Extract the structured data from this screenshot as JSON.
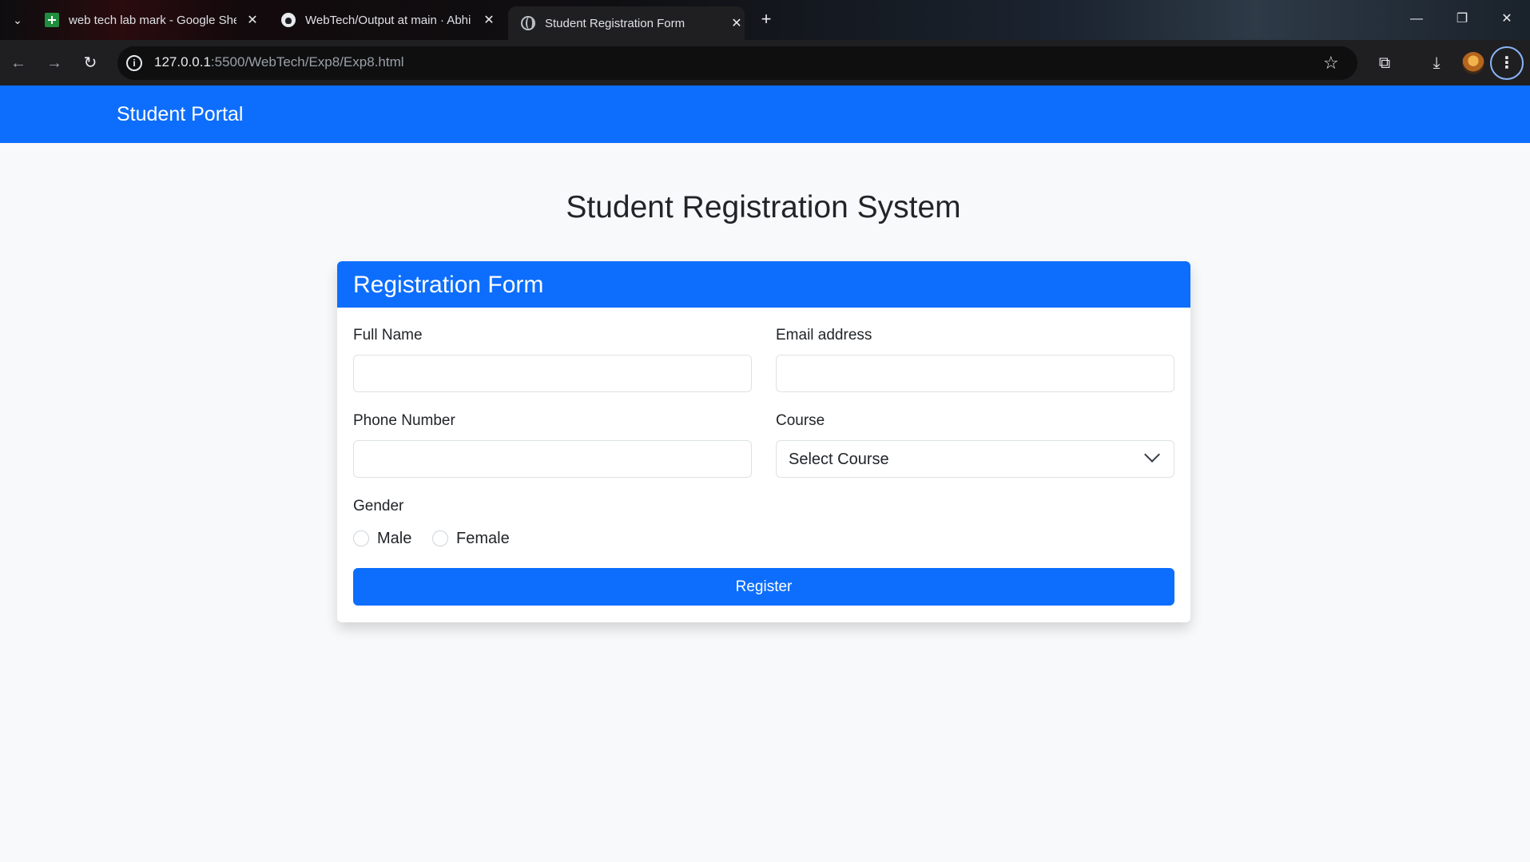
{
  "browser": {
    "tabs": [
      {
        "title": "web tech lab mark - Google Sheets",
        "icon": "sheets-icon"
      },
      {
        "title": "WebTech/Output at main · Abhi",
        "icon": "github-icon"
      },
      {
        "title": "Student Registration Form",
        "icon": "globe-icon",
        "active": true
      }
    ],
    "url_host": "127.0.0.1",
    "url_path": ":5500/WebTech/Exp8/Exp8.html"
  },
  "navbar": {
    "brand": "Student Portal"
  },
  "main": {
    "title": "Student Registration System"
  },
  "form": {
    "header": "Registration Form",
    "full_name_label": "Full Name",
    "full_name_value": "",
    "email_label": "Email address",
    "email_value": "",
    "phone_label": "Phone Number",
    "phone_value": "",
    "course_label": "Course",
    "course_selected": "Select Course",
    "gender_label": "Gender",
    "gender_options": [
      "Male",
      "Female"
    ],
    "submit_label": "Register"
  },
  "colors": {
    "primary": "#0d6efd",
    "page_bg": "#f8f9fa"
  }
}
